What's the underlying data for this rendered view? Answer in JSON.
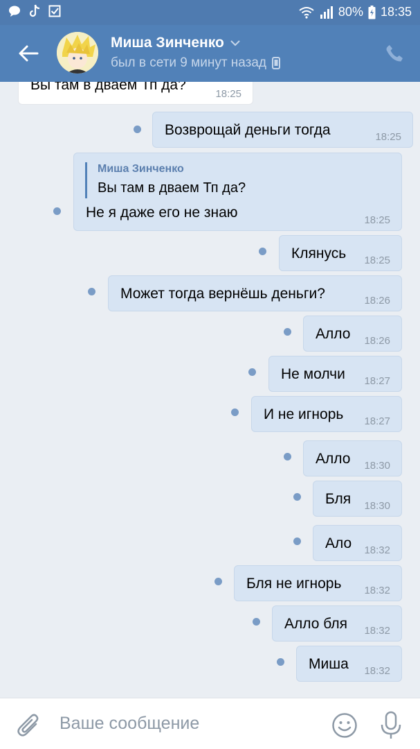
{
  "status_bar": {
    "battery": "80%",
    "time": "18:35",
    "icons": [
      "message-icon",
      "tiktok-icon",
      "checkbox-icon",
      "wifi-icon",
      "signal-icon",
      "battery-icon"
    ]
  },
  "header": {
    "name": "Миша Зинченко",
    "status": "был в сети 9 минут назад",
    "icons": [
      "back-arrow-icon",
      "chevron-down-icon",
      "mobile-device-icon",
      "phone-icon"
    ]
  },
  "messages": [
    {
      "direction": "in",
      "text": "Вы там в дваем Тп да?",
      "time": "18:25"
    },
    {
      "direction": "out",
      "text": "Возврощай деньги тогда",
      "time": "18:25"
    },
    {
      "direction": "out",
      "quote_author": "Миша Зинченко",
      "quote_text": "Вы там в дваем Тп да?",
      "text": "Не я даже его не знаю",
      "time": "18:25"
    },
    {
      "direction": "out",
      "text": "Клянусь",
      "time": "18:25"
    },
    {
      "direction": "out",
      "text": "Может тогда вернёшь деньги?",
      "time": "18:26"
    },
    {
      "direction": "out",
      "text": "Алло",
      "time": "18:26"
    },
    {
      "direction": "out",
      "text": "Не молчи",
      "time": "18:27"
    },
    {
      "direction": "out",
      "text": "И не игнорь",
      "time": "18:27"
    },
    {
      "direction": "out",
      "text": "Алло",
      "time": "18:30"
    },
    {
      "direction": "out",
      "text": "Бля",
      "time": "18:30"
    },
    {
      "direction": "out",
      "text": "Ало",
      "time": "18:32"
    },
    {
      "direction": "out",
      "text": "Бля не игнорь",
      "time": "18:32"
    },
    {
      "direction": "out",
      "text": "Алло бля",
      "time": "18:32"
    },
    {
      "direction": "out",
      "text": "Миша",
      "time": "18:32"
    }
  ],
  "composer": {
    "placeholder": "Ваше сообщение",
    "icons": [
      "paperclip-icon",
      "emoji-icon",
      "microphone-icon"
    ]
  },
  "colors": {
    "header": "#5181b8",
    "statusbar": "#4f7bb0",
    "outgoing_bubble": "#d7e4f3",
    "incoming_bubble": "#ffffff",
    "unread_dot": "#7a9cc6",
    "background": "#eaeef3"
  }
}
